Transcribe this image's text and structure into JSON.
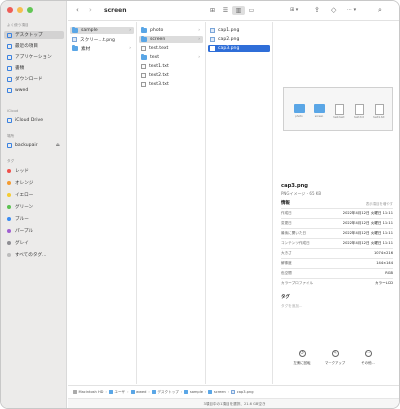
{
  "sidebar": {
    "favorites_header": "よく使う項目",
    "favorites": [
      {
        "label": "デスクトップ",
        "icon": "desktop-icon",
        "selected": true
      },
      {
        "label": "最近の項目",
        "icon": "clock-icon"
      },
      {
        "label": "アプリケーション",
        "icon": "apps-icon"
      },
      {
        "label": "書類",
        "icon": "document-icon"
      },
      {
        "label": "ダウンロード",
        "icon": "download-icon"
      },
      {
        "label": "wwed",
        "icon": "home-icon"
      }
    ],
    "icloud_header": "iCloud",
    "icloud": [
      {
        "label": "iCloud Drive",
        "icon": "cloud-icon"
      }
    ],
    "locations_header": "場所",
    "locations": [
      {
        "label": "backupair",
        "icon": "drive-icon",
        "eject": "⏏"
      }
    ],
    "tags_header": "タグ",
    "tags": [
      {
        "label": "レッド",
        "color": "#f0504a"
      },
      {
        "label": "オレンジ",
        "color": "#f59b30"
      },
      {
        "label": "イエロー",
        "color": "#f5cc32"
      },
      {
        "label": "グリーン",
        "color": "#5cc251"
      },
      {
        "label": "ブルー",
        "color": "#3b8cf2"
      },
      {
        "label": "パープル",
        "color": "#a05fd1"
      },
      {
        "label": "グレイ",
        "color": "#8e8e93"
      },
      {
        "label": "すべてのタグ...",
        "color": "#bdbdbd"
      }
    ]
  },
  "toolbar": {
    "back": "‹",
    "forward": "›",
    "title": "screen",
    "views": [
      "⊞",
      "☰",
      "▥",
      "▭"
    ],
    "group": "⊞ ▾",
    "share": "⇪",
    "tag": "◇",
    "more": "⋯ ▾",
    "search": "⌕"
  },
  "columns": {
    "col1": [
      {
        "label": "sample",
        "type": "folder",
        "state": "dim",
        "chevron": "›"
      },
      {
        "label": "スクリー…t.png",
        "type": "png"
      },
      {
        "label": "素材",
        "type": "folder",
        "chevron": "›"
      }
    ],
    "col2": [
      {
        "label": "photo",
        "type": "folder",
        "chevron": "›"
      },
      {
        "label": "screen",
        "type": "folder",
        "state": "dim",
        "chevron": "›"
      },
      {
        "label": "test.text",
        "type": "file"
      },
      {
        "label": "text",
        "type": "folder",
        "chevron": "›"
      },
      {
        "label": "text1.txt",
        "type": "file"
      },
      {
        "label": "text2.txt",
        "type": "file"
      },
      {
        "label": "text3.txt",
        "type": "file"
      }
    ],
    "col3": [
      {
        "label": "cap1.png",
        "type": "png"
      },
      {
        "label": "cap2.png",
        "type": "png"
      },
      {
        "label": "cap3.png",
        "type": "png",
        "state": "sel"
      }
    ]
  },
  "preview": {
    "thumb_items": [
      {
        "label": "photo",
        "kind": "folder"
      },
      {
        "label": "screen",
        "kind": "folder"
      },
      {
        "label": "test.text",
        "kind": "file"
      },
      {
        "label": "text.txt",
        "kind": "file"
      },
      {
        "label": "text1.txt",
        "kind": "file"
      }
    ],
    "name": "cap3.png",
    "kind": "PNGイメージ - 65 KB",
    "info_header": "情報",
    "show_more": "表示項目を増やす",
    "info": [
      {
        "k": "作成日",
        "v": "2022年4月12日 火曜日 11:11"
      },
      {
        "k": "変更日",
        "v": "2022年4月12日 火曜日 11:11"
      },
      {
        "k": "最後に開いた日",
        "v": "2022年4月12日 火曜日 11:11"
      },
      {
        "k": "コンテンツ作成日",
        "v": "2022年4月12日 火曜日 11:11"
      },
      {
        "k": "大きさ",
        "v": "1074×216"
      },
      {
        "k": "解像度",
        "v": "144×144"
      },
      {
        "k": "色空間",
        "v": "RGB"
      },
      {
        "k": "カラープロファイル",
        "v": "カラーLCD"
      }
    ],
    "tags_header": "タグ",
    "tags_placeholder": "タグを追加...",
    "actions": [
      {
        "label": "左側に回転",
        "icon": "rotate-left-icon",
        "glyph": "↺"
      },
      {
        "label": "マークアップ",
        "icon": "markup-icon",
        "glyph": "✎"
      },
      {
        "label": "その他...",
        "icon": "more-icon",
        "glyph": "⋯"
      }
    ]
  },
  "pathbar": [
    "Macintosh HD",
    "ユーザ",
    "wwed",
    "デスクトップ",
    "sample",
    "screen",
    "cap3.png"
  ],
  "status": "3項目中の1項目を選択、21.6 GB空き"
}
